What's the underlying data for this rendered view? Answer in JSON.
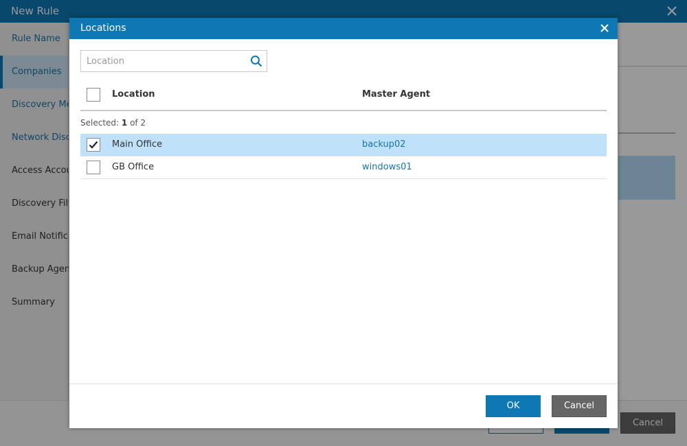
{
  "wizard": {
    "title": "New Rule",
    "nav": [
      {
        "label": "Rule Name",
        "state": "link"
      },
      {
        "label": "Companies",
        "state": "active"
      },
      {
        "label": "Discovery Met",
        "state": "link"
      },
      {
        "label": "Network Disco",
        "state": "link"
      },
      {
        "label": "Access Accour",
        "state": "normal"
      },
      {
        "label": "Discovery Filte",
        "state": "normal"
      },
      {
        "label": "Email Notificat",
        "state": "normal"
      },
      {
        "label": "Backup Agent",
        "state": "normal"
      },
      {
        "label": "Summary",
        "state": "normal"
      }
    ],
    "footer": {
      "cancel_label": "Cancel"
    }
  },
  "dialog": {
    "title": "Locations",
    "search": {
      "placeholder": "Location",
      "value": ""
    },
    "columns": {
      "location": "Location",
      "master_agent": "Master Agent"
    },
    "selected_prefix": "Selected:",
    "selected_count": "1",
    "selected_of": "of 2",
    "rows": [
      {
        "location": "Main Office",
        "master_agent": "backup02",
        "checked": true
      },
      {
        "location": "GB Office",
        "master_agent": "windows01",
        "checked": false
      }
    ],
    "ok_label": "OK",
    "cancel_label": "Cancel"
  },
  "colors": {
    "accent": "#0d78b4",
    "selection": "#bfe2fa",
    "link": "#1a73a8",
    "cancel_button": "#666666"
  },
  "icons": {
    "close": "close-icon",
    "search": "search-icon",
    "check": "checkmark-icon"
  }
}
